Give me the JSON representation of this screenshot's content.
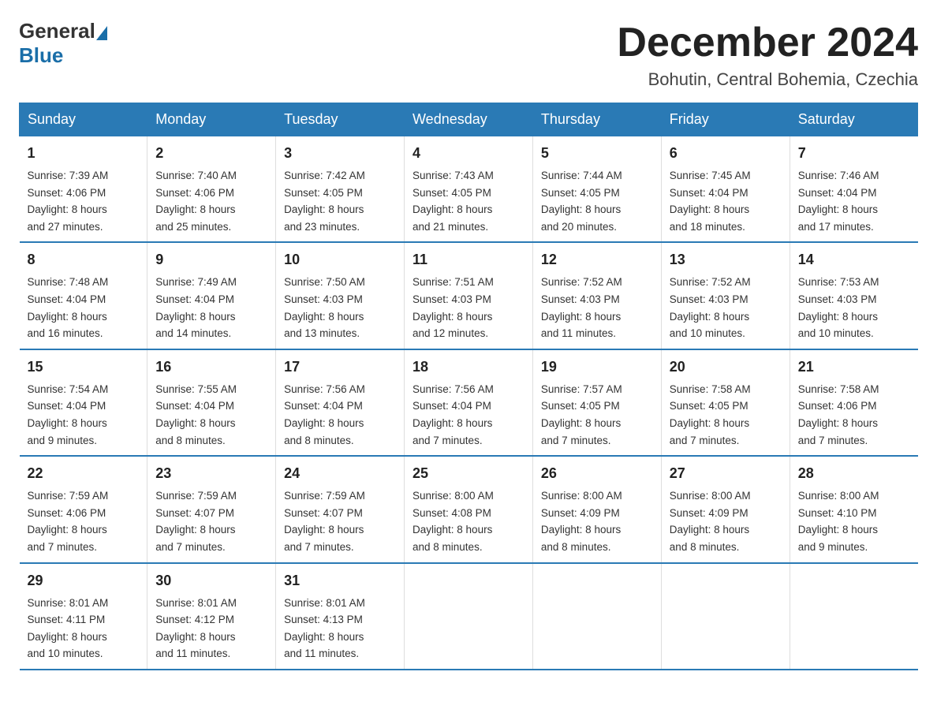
{
  "header": {
    "logo_general": "General",
    "logo_blue": "Blue",
    "title": "December 2024",
    "subtitle": "Bohutin, Central Bohemia, Czechia"
  },
  "weekdays": [
    "Sunday",
    "Monday",
    "Tuesday",
    "Wednesday",
    "Thursday",
    "Friday",
    "Saturday"
  ],
  "weeks": [
    [
      {
        "day": "1",
        "sunrise": "7:39 AM",
        "sunset": "4:06 PM",
        "daylight": "8 hours and 27 minutes."
      },
      {
        "day": "2",
        "sunrise": "7:40 AM",
        "sunset": "4:06 PM",
        "daylight": "8 hours and 25 minutes."
      },
      {
        "day": "3",
        "sunrise": "7:42 AM",
        "sunset": "4:05 PM",
        "daylight": "8 hours and 23 minutes."
      },
      {
        "day": "4",
        "sunrise": "7:43 AM",
        "sunset": "4:05 PM",
        "daylight": "8 hours and 21 minutes."
      },
      {
        "day": "5",
        "sunrise": "7:44 AM",
        "sunset": "4:05 PM",
        "daylight": "8 hours and 20 minutes."
      },
      {
        "day": "6",
        "sunrise": "7:45 AM",
        "sunset": "4:04 PM",
        "daylight": "8 hours and 18 minutes."
      },
      {
        "day": "7",
        "sunrise": "7:46 AM",
        "sunset": "4:04 PM",
        "daylight": "8 hours and 17 minutes."
      }
    ],
    [
      {
        "day": "8",
        "sunrise": "7:48 AM",
        "sunset": "4:04 PM",
        "daylight": "8 hours and 16 minutes."
      },
      {
        "day": "9",
        "sunrise": "7:49 AM",
        "sunset": "4:04 PM",
        "daylight": "8 hours and 14 minutes."
      },
      {
        "day": "10",
        "sunrise": "7:50 AM",
        "sunset": "4:03 PM",
        "daylight": "8 hours and 13 minutes."
      },
      {
        "day": "11",
        "sunrise": "7:51 AM",
        "sunset": "4:03 PM",
        "daylight": "8 hours and 12 minutes."
      },
      {
        "day": "12",
        "sunrise": "7:52 AM",
        "sunset": "4:03 PM",
        "daylight": "8 hours and 11 minutes."
      },
      {
        "day": "13",
        "sunrise": "7:52 AM",
        "sunset": "4:03 PM",
        "daylight": "8 hours and 10 minutes."
      },
      {
        "day": "14",
        "sunrise": "7:53 AM",
        "sunset": "4:03 PM",
        "daylight": "8 hours and 10 minutes."
      }
    ],
    [
      {
        "day": "15",
        "sunrise": "7:54 AM",
        "sunset": "4:04 PM",
        "daylight": "8 hours and 9 minutes."
      },
      {
        "day": "16",
        "sunrise": "7:55 AM",
        "sunset": "4:04 PM",
        "daylight": "8 hours and 8 minutes."
      },
      {
        "day": "17",
        "sunrise": "7:56 AM",
        "sunset": "4:04 PM",
        "daylight": "8 hours and 8 minutes."
      },
      {
        "day": "18",
        "sunrise": "7:56 AM",
        "sunset": "4:04 PM",
        "daylight": "8 hours and 7 minutes."
      },
      {
        "day": "19",
        "sunrise": "7:57 AM",
        "sunset": "4:05 PM",
        "daylight": "8 hours and 7 minutes."
      },
      {
        "day": "20",
        "sunrise": "7:58 AM",
        "sunset": "4:05 PM",
        "daylight": "8 hours and 7 minutes."
      },
      {
        "day": "21",
        "sunrise": "7:58 AM",
        "sunset": "4:06 PM",
        "daylight": "8 hours and 7 minutes."
      }
    ],
    [
      {
        "day": "22",
        "sunrise": "7:59 AM",
        "sunset": "4:06 PM",
        "daylight": "8 hours and 7 minutes."
      },
      {
        "day": "23",
        "sunrise": "7:59 AM",
        "sunset": "4:07 PM",
        "daylight": "8 hours and 7 minutes."
      },
      {
        "day": "24",
        "sunrise": "7:59 AM",
        "sunset": "4:07 PM",
        "daylight": "8 hours and 7 minutes."
      },
      {
        "day": "25",
        "sunrise": "8:00 AM",
        "sunset": "4:08 PM",
        "daylight": "8 hours and 8 minutes."
      },
      {
        "day": "26",
        "sunrise": "8:00 AM",
        "sunset": "4:09 PM",
        "daylight": "8 hours and 8 minutes."
      },
      {
        "day": "27",
        "sunrise": "8:00 AM",
        "sunset": "4:09 PM",
        "daylight": "8 hours and 8 minutes."
      },
      {
        "day": "28",
        "sunrise": "8:00 AM",
        "sunset": "4:10 PM",
        "daylight": "8 hours and 9 minutes."
      }
    ],
    [
      {
        "day": "29",
        "sunrise": "8:01 AM",
        "sunset": "4:11 PM",
        "daylight": "8 hours and 10 minutes."
      },
      {
        "day": "30",
        "sunrise": "8:01 AM",
        "sunset": "4:12 PM",
        "daylight": "8 hours and 11 minutes."
      },
      {
        "day": "31",
        "sunrise": "8:01 AM",
        "sunset": "4:13 PM",
        "daylight": "8 hours and 11 minutes."
      },
      null,
      null,
      null,
      null
    ]
  ],
  "labels": {
    "sunrise": "Sunrise:",
    "sunset": "Sunset:",
    "daylight": "Daylight:"
  }
}
